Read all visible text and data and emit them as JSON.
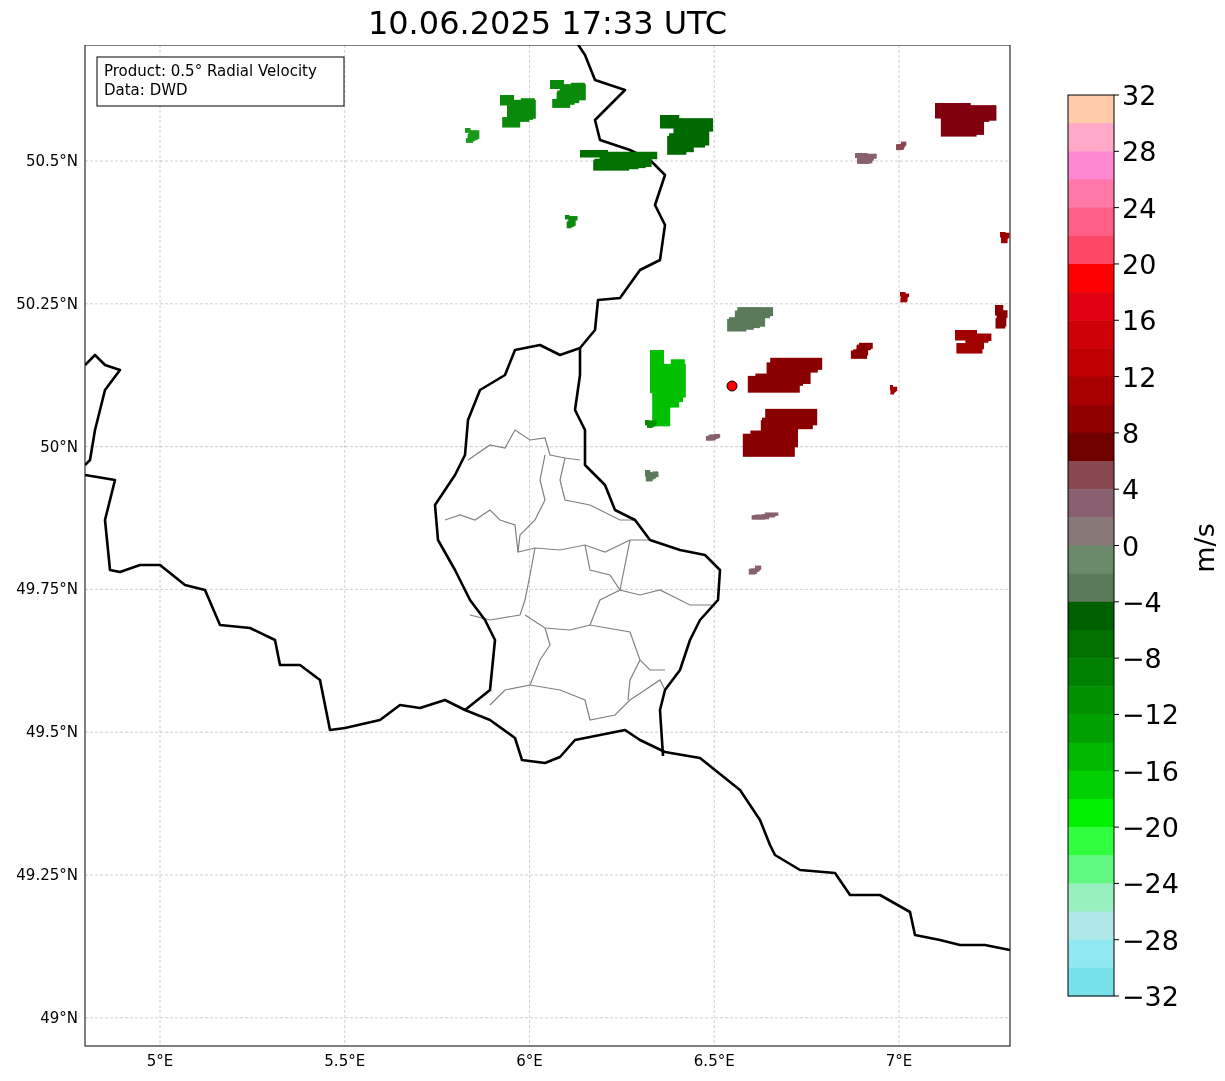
{
  "title": "10.06.2025 17:33 UTC",
  "map": {
    "legend": [
      "Product: 0.5° Radial Velocity",
      "Data: DWD"
    ],
    "lat_labels": [
      "50.5°N",
      "50.25°N",
      "50°N",
      "49.75°N",
      "49.5°N",
      "49.25°N",
      "49°N"
    ],
    "lon_labels": [
      "5°E",
      "5.5°E",
      "6°E",
      "6.5°E",
      "7°E"
    ]
  },
  "colorbar": {
    "label": "m/s",
    "ticks": [
      "32",
      "28",
      "24",
      "20",
      "16",
      "12",
      "8",
      "4",
      "0",
      "−4",
      "−8",
      "−12",
      "−16",
      "−20",
      "−24",
      "−28",
      "−32"
    ],
    "segments": [
      {
        "color": "#ffcba8"
      },
      {
        "color": "#ffa8c8"
      },
      {
        "color": "#ff88d0"
      },
      {
        "color": "#ff78a8"
      },
      {
        "color": "#ff6088"
      },
      {
        "color": "#ff4868"
      },
      {
        "color": "#ff0000"
      },
      {
        "color": "#e00010"
      },
      {
        "color": "#d00008"
      },
      {
        "color": "#c00000"
      },
      {
        "color": "#a80000"
      },
      {
        "color": "#900000"
      },
      {
        "color": "#700000"
      },
      {
        "color": "#884850"
      },
      {
        "color": "#886070"
      },
      {
        "color": "#887878"
      },
      {
        "color": "#6a8a6a"
      },
      {
        "color": "#5a7a5a"
      },
      {
        "color": "#006000"
      },
      {
        "color": "#007000"
      },
      {
        "color": "#008000"
      },
      {
        "color": "#009000"
      },
      {
        "color": "#00a000"
      },
      {
        "color": "#00b800"
      },
      {
        "color": "#00d000"
      },
      {
        "color": "#00f000"
      },
      {
        "color": "#30ff40"
      },
      {
        "color": "#60f880"
      },
      {
        "color": "#98f0c0"
      },
      {
        "color": "#b0e8e8"
      },
      {
        "color": "#90e8f0"
      },
      {
        "color": "#78e0e8"
      }
    ]
  }
}
